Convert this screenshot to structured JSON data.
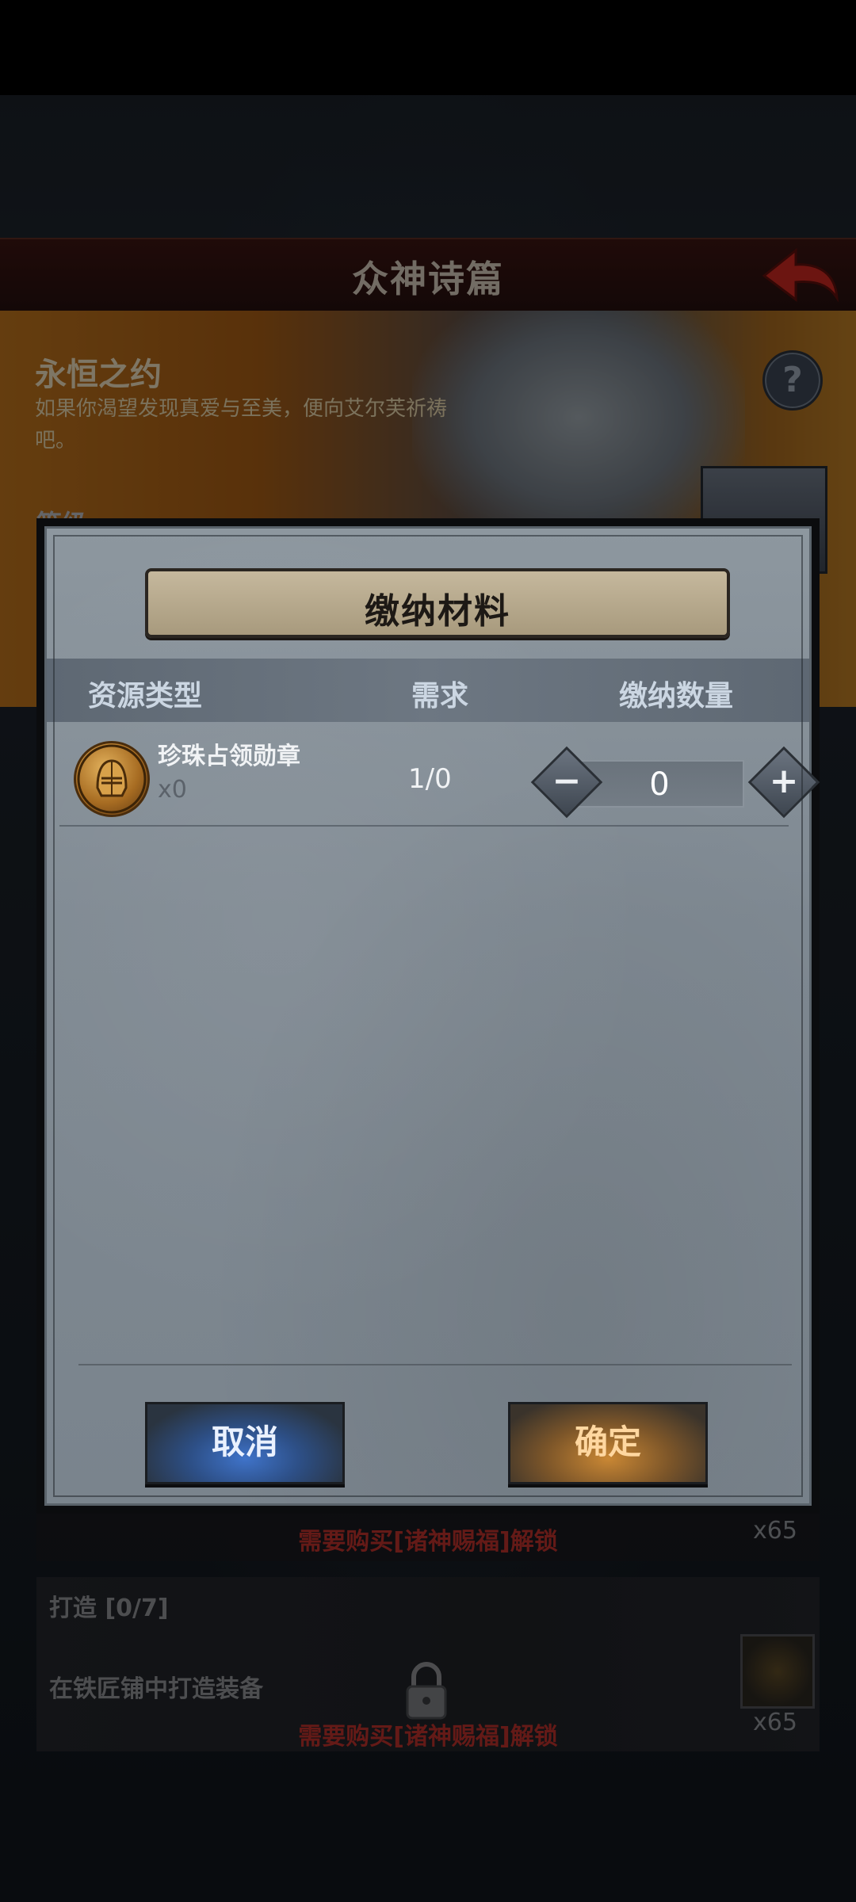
{
  "screen": {
    "title": "众神诗篇",
    "back_icon": "back-arrow-icon"
  },
  "banner": {
    "title": "永恒之约",
    "description": "如果你渴望发现真爱与至美，便向艾尔芙祈祷吧。",
    "help_icon": "question-mark-icon",
    "help_symbol": "?"
  },
  "background_tasks": {
    "partial_label": "等级",
    "lock_text_1": "需要购买[诸神赐福]解锁",
    "reward_count_1": "x65",
    "craft_title": "打造 [0/7]",
    "craft_desc": "在铁匠铺中打造装备",
    "lock_text_2": "需要购买[诸神赐福]解锁",
    "reward_count_2": "x65"
  },
  "dialog": {
    "title": "缴纳材料",
    "columns": {
      "type": "资源类型",
      "need": "需求",
      "count": "缴纳数量"
    },
    "items": [
      {
        "name": "珍珠占领勋章",
        "owned": "x0",
        "need": "1/0",
        "submit_count": "0",
        "icon": "knight-helmet-medal-icon"
      }
    ],
    "stepper": {
      "minus": "−",
      "plus": "+"
    },
    "cancel_label": "取消",
    "confirm_label": "确定"
  },
  "colors": {
    "cancel_accent": "#3f73c9",
    "confirm_accent": "#c98734",
    "lock_text": "#b6302b"
  }
}
